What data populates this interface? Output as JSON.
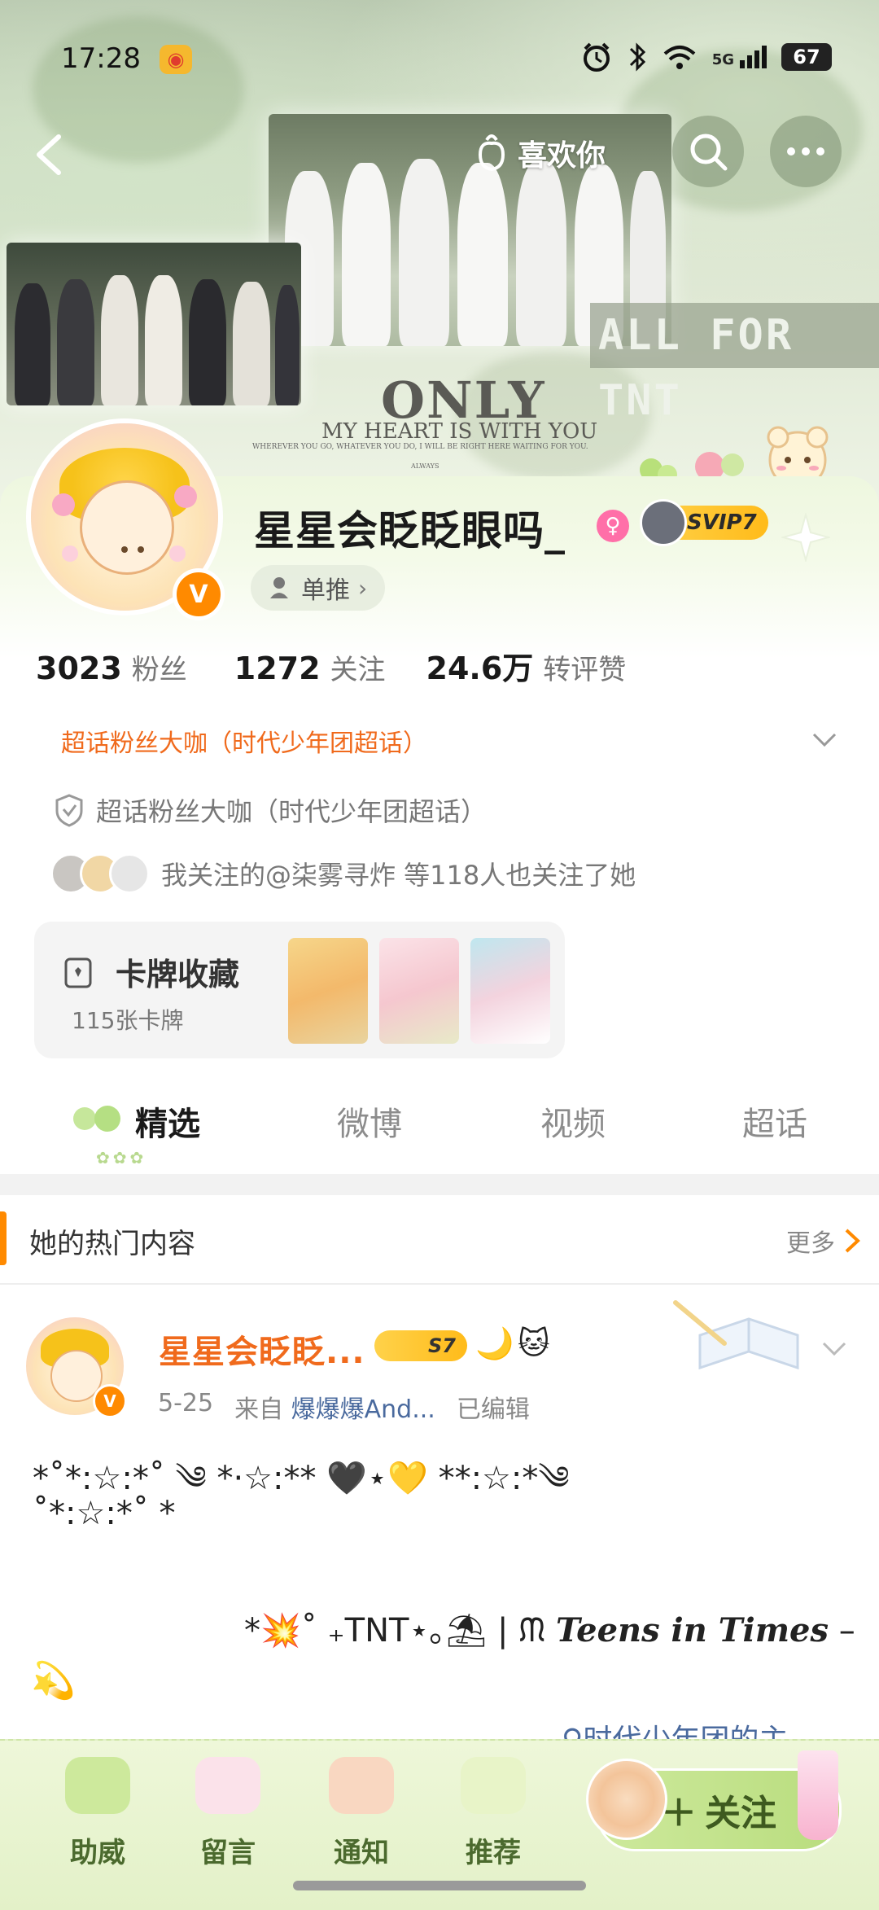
{
  "status_bar": {
    "time": "17:28",
    "network": "5G",
    "battery": "67"
  },
  "nav": {
    "like_label": "喜欢你"
  },
  "cover": {
    "banner_text": "ALL FOR TNT",
    "only_text": "ONLY",
    "heart_text": "MY HEART IS WITH YOU",
    "small_text_1": "WHEREVER YOU GO, WHATEVER YOU DO, I WILL BE RIGHT HERE WAITING FOR YOU.",
    "small_text_2": "ALWAYS"
  },
  "profile": {
    "username": "星星会眨眨眼吗_",
    "svip_label": "SVIP7",
    "tag_label": "单推",
    "stats": [
      {
        "num": "3023",
        "label": "粉丝"
      },
      {
        "num": "1272",
        "label": "关注"
      },
      {
        "num": "24.6万",
        "label": "转评赞"
      }
    ],
    "fan_title": "超话粉丝大咖（时代少年团超话）",
    "fan_line": "超话粉丝大咖（时代少年团超话）",
    "followers_line": "我关注的@柒雾寻炸 等118人也关注了她"
  },
  "cards": {
    "title": "卡牌收藏",
    "count": "115张卡牌"
  },
  "tabs": {
    "items": [
      "精选",
      "微博",
      "视频",
      "超话"
    ]
  },
  "hot": {
    "title": "她的热门内容",
    "more": "更多"
  },
  "post": {
    "name": "星星会眨眨...",
    "badge": "S7",
    "date": "5-25",
    "from_label": "来自",
    "source": "爆爆爆And...",
    "edited": "已编辑",
    "line1": "*˚*:☆:*˚ ༄ *·☆:** 🖤⋆💛 **:☆:*༄",
    "line2": "˚*:☆:*˚ *",
    "line3_prefix": "*💥˚ ₊TNT⋆｡⛱ | ᙏ",
    "line3_teens": "Teens in Times",
    "line3_suffix": "–",
    "line4": "💫",
    "link": "♀时代少年团的主"
  },
  "bottom_bar": {
    "items": [
      "助威",
      "留言",
      "通知",
      "推荐"
    ],
    "follow_label": "关注"
  }
}
